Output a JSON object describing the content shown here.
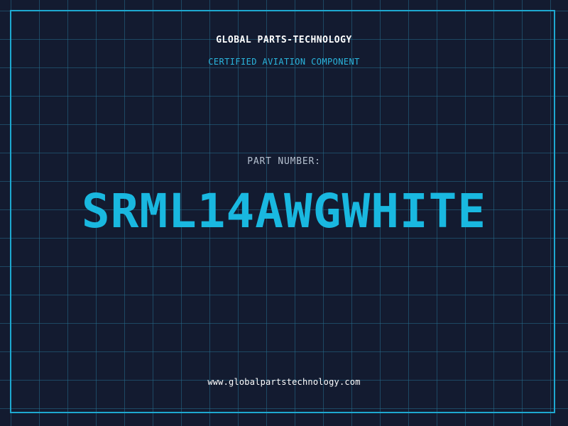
{
  "header": {
    "company": "GLOBAL PARTS-TECHNOLOGY",
    "subtitle": "CERTIFIED AVIATION COMPONENT"
  },
  "part": {
    "label": "PART NUMBER:",
    "number": "SRML14AWGWHITE"
  },
  "footer": {
    "website": "www.globalpartstechnology.com"
  },
  "colors": {
    "background": "#131b30",
    "grid": "#246e8c",
    "accent": "#1ea8d0",
    "text_primary": "#ffffff",
    "text_muted": "#b4c0cf"
  }
}
